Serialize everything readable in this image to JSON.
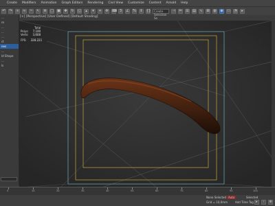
{
  "menubar": {
    "items": [
      "Create",
      "Modifiers",
      "Animation",
      "Graph Editors",
      "Rendering",
      "Civil View",
      "Customize",
      "Content",
      "Arnold",
      "Help"
    ]
  },
  "toolbar": {
    "selection_set_label": "Create Selection Se"
  },
  "left_panel": {
    "items": [
      "...",
      "ro",
      "...",
      "...",
      "...",
      "ct",
      "nes",
      "...",
      "ld Shape",
      "...",
      "ls"
    ],
    "selected_index": 6
  },
  "viewport": {
    "label": "[+] [Perspective] [User Defined] [Default Shading]",
    "stats": {
      "title": "Total",
      "polys_label": "Polys:",
      "polys_value": "7,100",
      "verts_label": "Verts:",
      "verts_value": "3,608",
      "fps_label": "FPS:",
      "fps_value": "328.221"
    },
    "colors": {
      "object": "#4a2412",
      "safe_frame_outer": "#6aa0b0",
      "safe_frame_inner": "#b89a3a"
    }
  },
  "timeline": {
    "ticks": [
      "0",
      "10",
      "20",
      "30",
      "40",
      "50",
      "60",
      "70",
      "80",
      "90",
      "100"
    ]
  },
  "statusbar": {
    "selected_text": "None Selected",
    "grid_text": "Grid = 10,0mm",
    "key_text": "Add Time Tag",
    "auto_text": "Auto",
    "selected_label": "Selected"
  }
}
